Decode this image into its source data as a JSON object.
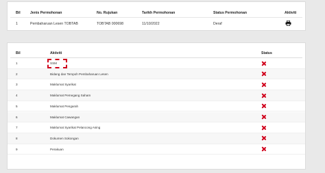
{
  "application_table": {
    "headers": [
      "Bil",
      "Jenis Permohonan",
      "No. Rujukan",
      "Tarikh Permohonan",
      "Status Permohonan",
      "Aktiviti"
    ],
    "row": {
      "bil": "1",
      "jenis": "Pembaharuan Lesen TOBTAB",
      "rujukan": "TOBTAB 000698",
      "tarikh": "11/10/2022",
      "status": "Deraf",
      "action_icon": "printer-icon"
    }
  },
  "activity_table": {
    "headers": [
      "Bil",
      "Aktiviti",
      "Status"
    ],
    "rows": [
      {
        "bil": "1",
        "aktiviti": "SSM",
        "status_icon": "x-icon"
      },
      {
        "bil": "2",
        "aktiviti": "Bidang dan Tempoh Pembaharuan Lesen",
        "status_icon": "x-icon"
      },
      {
        "bil": "3",
        "aktiviti": "Maklumat Syarikat",
        "status_icon": "x-icon"
      },
      {
        "bil": "4",
        "aktiviti": "Maklumat Pemegang Saham",
        "status_icon": "x-icon"
      },
      {
        "bil": "5",
        "aktiviti": "Maklumat Pengarah",
        "status_icon": "x-icon"
      },
      {
        "bil": "6",
        "aktiviti": "Maklumat Cawangan",
        "status_icon": "x-icon"
      },
      {
        "bil": "7",
        "aktiviti": "Maklumat Syarikat Pelancong Asing",
        "status_icon": "x-icon"
      },
      {
        "bil": "8",
        "aktiviti": "Dokumen Sokongan",
        "status_icon": "x-icon"
      },
      {
        "bil": "9",
        "aktiviti": "Perakuan",
        "status_icon": "x-icon"
      }
    ]
  },
  "colors": {
    "status_incomplete": "#d0021b",
    "highlight": "#d0021b"
  }
}
